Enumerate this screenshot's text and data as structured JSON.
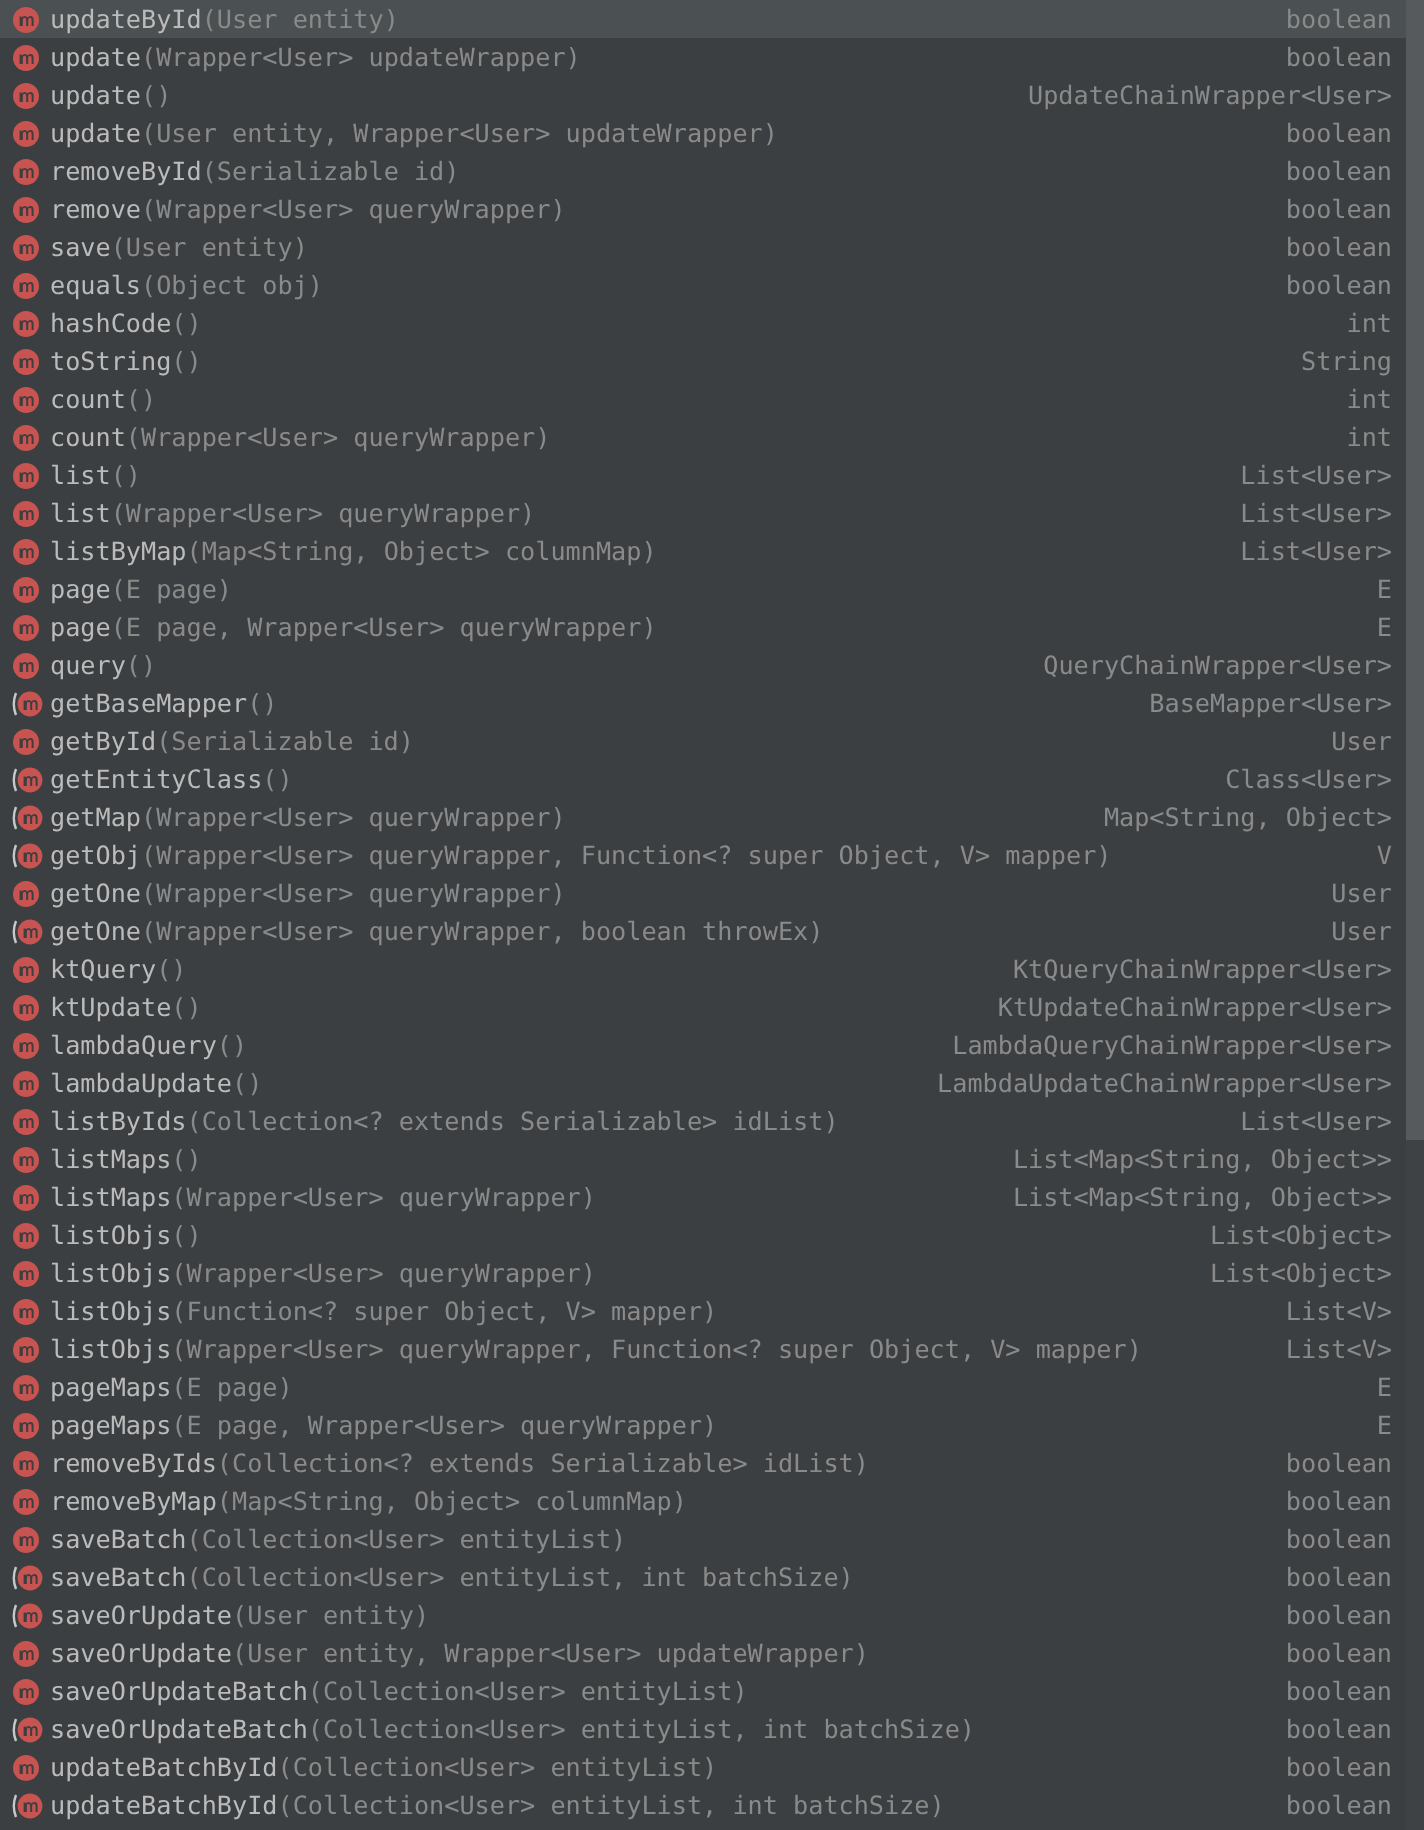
{
  "completions": [
    {
      "name": "updateById",
      "params": "(User entity)",
      "type": "boolean",
      "kind": "method",
      "selected": true
    },
    {
      "name": "update",
      "params": "(Wrapper<User> updateWrapper)",
      "type": "boolean",
      "kind": "method",
      "selected": false
    },
    {
      "name": "update",
      "params": "()",
      "type": "UpdateChainWrapper<User>",
      "kind": "method",
      "selected": false
    },
    {
      "name": "update",
      "params": "(User entity, Wrapper<User> updateWrapper)",
      "type": "boolean",
      "kind": "method",
      "selected": false
    },
    {
      "name": "removeById",
      "params": "(Serializable id)",
      "type": "boolean",
      "kind": "method",
      "selected": false
    },
    {
      "name": "remove",
      "params": "(Wrapper<User> queryWrapper)",
      "type": "boolean",
      "kind": "method",
      "selected": false
    },
    {
      "name": "save",
      "params": "(User entity)",
      "type": "boolean",
      "kind": "method",
      "selected": false
    },
    {
      "name": "equals",
      "params": "(Object obj)",
      "type": "boolean",
      "kind": "method",
      "selected": false
    },
    {
      "name": "hashCode",
      "params": "()",
      "type": "int",
      "kind": "method",
      "selected": false
    },
    {
      "name": "toString",
      "params": "()",
      "type": "String",
      "kind": "method",
      "selected": false
    },
    {
      "name": "count",
      "params": "()",
      "type": "int",
      "kind": "method",
      "selected": false
    },
    {
      "name": "count",
      "params": "(Wrapper<User> queryWrapper)",
      "type": "int",
      "kind": "method",
      "selected": false
    },
    {
      "name": "list",
      "params": "()",
      "type": "List<User>",
      "kind": "method",
      "selected": false
    },
    {
      "name": "list",
      "params": "(Wrapper<User> queryWrapper)",
      "type": "List<User>",
      "kind": "method",
      "selected": false
    },
    {
      "name": "listByMap",
      "params": "(Map<String, Object> columnMap)",
      "type": "List<User>",
      "kind": "method",
      "selected": false
    },
    {
      "name": "page",
      "params": "(E page)",
      "type": "E",
      "kind": "method",
      "selected": false
    },
    {
      "name": "page",
      "params": "(E page, Wrapper<User> queryWrapper)",
      "type": "E",
      "kind": "method",
      "selected": false
    },
    {
      "name": "query",
      "params": "()",
      "type": "QueryChainWrapper<User>",
      "kind": "method",
      "selected": false
    },
    {
      "name": "getBaseMapper",
      "params": "()",
      "type": "BaseMapper<User>",
      "kind": "bracketed",
      "selected": false
    },
    {
      "name": "getById",
      "params": "(Serializable id)",
      "type": "User",
      "kind": "method",
      "selected": false
    },
    {
      "name": "getEntityClass",
      "params": "()",
      "type": "Class<User>",
      "kind": "bracketed",
      "selected": false
    },
    {
      "name": "getMap",
      "params": "(Wrapper<User> queryWrapper)",
      "type": "Map<String, Object>",
      "kind": "bracketed",
      "selected": false
    },
    {
      "name": "getObj",
      "params": "(Wrapper<User> queryWrapper, Function<? super Object, V> mapper)",
      "type": "V",
      "kind": "bracketed",
      "selected": false
    },
    {
      "name": "getOne",
      "params": "(Wrapper<User> queryWrapper)",
      "type": "User",
      "kind": "method",
      "selected": false
    },
    {
      "name": "getOne",
      "params": "(Wrapper<User> queryWrapper, boolean throwEx)",
      "type": "User",
      "kind": "bracketed",
      "selected": false
    },
    {
      "name": "ktQuery",
      "params": "()",
      "type": "KtQueryChainWrapper<User>",
      "kind": "method",
      "selected": false
    },
    {
      "name": "ktUpdate",
      "params": "()",
      "type": "KtUpdateChainWrapper<User>",
      "kind": "method",
      "selected": false
    },
    {
      "name": "lambdaQuery",
      "params": "()",
      "type": "LambdaQueryChainWrapper<User>",
      "kind": "method",
      "selected": false
    },
    {
      "name": "lambdaUpdate",
      "params": "()",
      "type": "LambdaUpdateChainWrapper<User>",
      "kind": "method",
      "selected": false
    },
    {
      "name": "listByIds",
      "params": "(Collection<? extends Serializable> idList)",
      "type": "List<User>",
      "kind": "method",
      "selected": false
    },
    {
      "name": "listMaps",
      "params": "()",
      "type": "List<Map<String, Object>>",
      "kind": "method",
      "selected": false
    },
    {
      "name": "listMaps",
      "params": "(Wrapper<User> queryWrapper)",
      "type": "List<Map<String, Object>>",
      "kind": "method",
      "selected": false
    },
    {
      "name": "listObjs",
      "params": "()",
      "type": "List<Object>",
      "kind": "method",
      "selected": false
    },
    {
      "name": "listObjs",
      "params": "(Wrapper<User> queryWrapper)",
      "type": "List<Object>",
      "kind": "method",
      "selected": false
    },
    {
      "name": "listObjs",
      "params": "(Function<? super Object, V> mapper)",
      "type": "List<V>",
      "kind": "method",
      "selected": false
    },
    {
      "name": "listObjs",
      "params": "(Wrapper<User> queryWrapper, Function<? super Object, V> mapper)",
      "type": "List<V>",
      "kind": "method",
      "selected": false
    },
    {
      "name": "pageMaps",
      "params": "(E page)",
      "type": "E",
      "kind": "method",
      "selected": false
    },
    {
      "name": "pageMaps",
      "params": "(E page, Wrapper<User> queryWrapper)",
      "type": "E",
      "kind": "method",
      "selected": false
    },
    {
      "name": "removeByIds",
      "params": "(Collection<? extends Serializable> idList)",
      "type": "boolean",
      "kind": "method",
      "selected": false
    },
    {
      "name": "removeByMap",
      "params": "(Map<String, Object> columnMap)",
      "type": "boolean",
      "kind": "method",
      "selected": false
    },
    {
      "name": "saveBatch",
      "params": "(Collection<User> entityList)",
      "type": "boolean",
      "kind": "method",
      "selected": false
    },
    {
      "name": "saveBatch",
      "params": "(Collection<User> entityList, int batchSize)",
      "type": "boolean",
      "kind": "bracketed",
      "selected": false
    },
    {
      "name": "saveOrUpdate",
      "params": "(User entity)",
      "type": "boolean",
      "kind": "bracketed",
      "selected": false
    },
    {
      "name": "saveOrUpdate",
      "params": "(User entity, Wrapper<User> updateWrapper)",
      "type": "boolean",
      "kind": "method",
      "selected": false
    },
    {
      "name": "saveOrUpdateBatch",
      "params": "(Collection<User> entityList)",
      "type": "boolean",
      "kind": "method",
      "selected": false
    },
    {
      "name": "saveOrUpdateBatch",
      "params": "(Collection<User> entityList, int batchSize)",
      "type": "boolean",
      "kind": "bracketed",
      "selected": false
    },
    {
      "name": "updateBatchById",
      "params": "(Collection<User> entityList)",
      "type": "boolean",
      "kind": "method",
      "selected": false
    },
    {
      "name": "updateBatchById",
      "params": "(Collection<User> entityList, int batchSize)",
      "type": "boolean",
      "kind": "bracketed",
      "selected": false
    }
  ]
}
